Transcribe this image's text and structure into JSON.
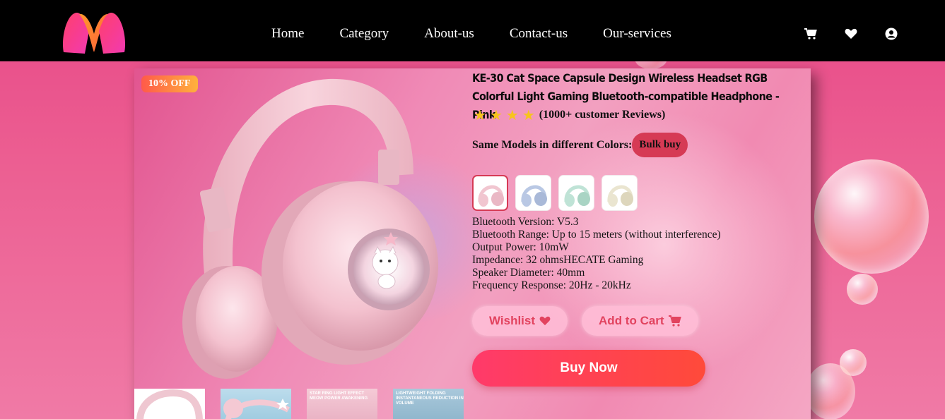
{
  "header": {
    "logo_name": "myntra-logo",
    "nav": [
      "Home",
      "Category",
      "About-us",
      "Contact-us",
      "Our-services"
    ],
    "icons": [
      "cart-icon",
      "heart-icon",
      "user-icon"
    ]
  },
  "product": {
    "discount": "10% OFF",
    "title": "KE-30 Cat Space Capsule Design Wireless Headset RGB Colorful Light Gaming Bluetooth-compatible Headphone - Pink",
    "rating_stars": 4,
    "reviews": "(1000+ customer Reviews)",
    "colors_label": "Same Models in different Colors:",
    "bulk_label": "Bulk buy",
    "swatches": [
      {
        "name": "pink",
        "color": "#f1c6d0"
      },
      {
        "name": "blue",
        "color": "#b9c8e4"
      },
      {
        "name": "mint",
        "color": "#bfe3d6"
      },
      {
        "name": "cream",
        "color": "#eae5d0"
      }
    ],
    "specs": [
      "Bluetooth Version: V5.3",
      "Bluetooth Range: Up to 15 meters (without interference)",
      "Output Power: 10mW",
      "Impedance: 32 ohmsHECATE Gaming",
      "Speaker Diameter: 40mm",
      "Frequency Response: 20Hz - 20kHz"
    ],
    "wishlist_label": "Wishlist",
    "cart_label": "Add to Cart",
    "buy_label": "Buy Now",
    "thumbnails": [
      {
        "caption": ""
      },
      {
        "caption": ""
      },
      {
        "caption": "STAR RING LIGHT EFFECT MEOW POWER AWAKENING"
      },
      {
        "caption": "LIGHTWEIGHT FOLDING INSTANTANEOUS REDUCTION IN VOLUME"
      }
    ]
  },
  "colors": {
    "accent": "#d63a55",
    "header_bg": "#000000",
    "star": "#f7c41b"
  }
}
